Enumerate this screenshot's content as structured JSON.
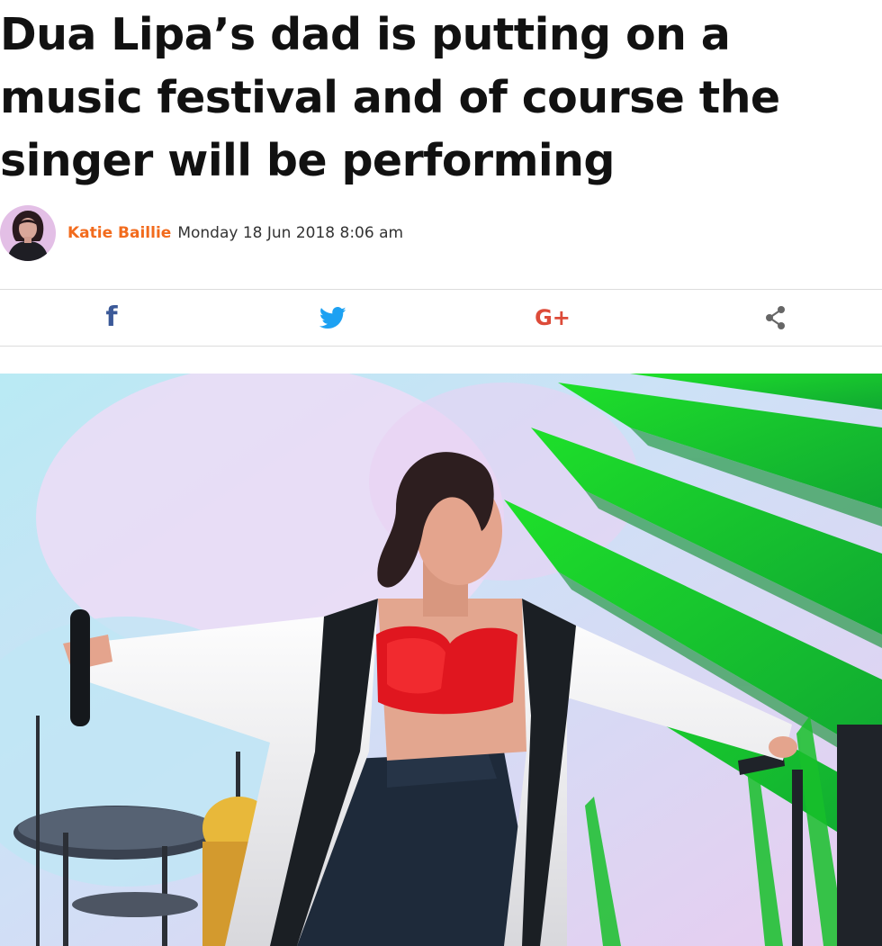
{
  "article": {
    "headline": "Dua Lipa’s dad is putting on a music festival and of course the singer will be performing",
    "author": "Katie Baillie",
    "date": "Monday 18 Jun 2018 8:06 am"
  },
  "share": {
    "facebook_glyph": "f",
    "googleplus_glyph": "G+"
  },
  "colors": {
    "accent": "#f26b1d",
    "facebook": "#3b5998",
    "twitter": "#1da1f2",
    "googleplus": "#dd4b39",
    "share_neutral": "#666666"
  },
  "icons": [
    "author-avatar",
    "facebook-icon",
    "twitter-icon",
    "google-plus-icon",
    "share-icon"
  ]
}
